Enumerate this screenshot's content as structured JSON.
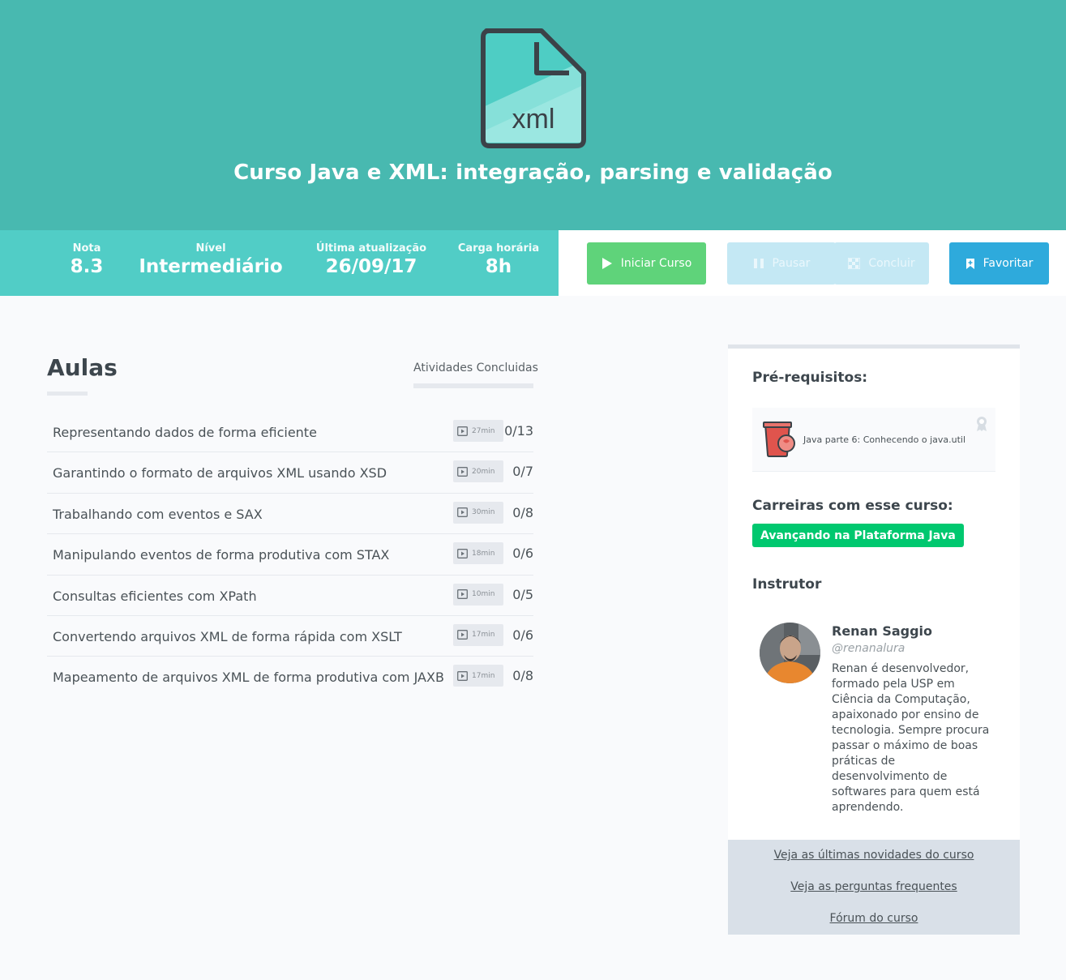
{
  "course": {
    "title": "Curso Java e XML: integração, parsing e validação",
    "icon": "xml-file-icon",
    "icon_text": "xml"
  },
  "stats": [
    {
      "label": "Nota",
      "value": "8.3"
    },
    {
      "label": "Nível",
      "value": "Intermediário"
    },
    {
      "label": "Última atualização",
      "value": "26/09/17"
    },
    {
      "label": "Carga horária",
      "value": "8h"
    }
  ],
  "actions": {
    "start": "Iniciar Curso",
    "pause": "Pausar",
    "finish": "Concluir",
    "favorite": "Favoritar"
  },
  "lessons": {
    "title": "Aulas",
    "done_label": "Atividades Concluidas",
    "items": [
      {
        "name": "Representando dados de forma eficiente",
        "duration": "27min",
        "progress": "0/13"
      },
      {
        "name": "Garantindo o formato de arquivos XML usando XSD",
        "duration": "20min",
        "progress": "0/7"
      },
      {
        "name": "Trabalhando com eventos e SAX",
        "duration": "30min",
        "progress": "0/8"
      },
      {
        "name": "Manipulando eventos de forma produtiva com STAX",
        "duration": "18min",
        "progress": "0/6"
      },
      {
        "name": "Consultas eficientes com XPath",
        "duration": "10min",
        "progress": "0/5"
      },
      {
        "name": "Convertendo arquivos XML de forma rápida com XSLT",
        "duration": "17min",
        "progress": "0/6"
      },
      {
        "name": "Mapeamento de arquivos XML de forma produtiva com JAXB",
        "duration": "17min",
        "progress": "0/8"
      }
    ]
  },
  "sidebar": {
    "prereq_title": "Pré-requisitos:",
    "prereq_course": "Java parte 6: Conhecendo o java.util",
    "careers_title": "Carreiras com esse curso:",
    "career": "Avançando na Plataforma Java",
    "instructor_title": "Instrutor",
    "instructor": {
      "name": "Renan Saggio",
      "handle": "@renanalura",
      "bio": "Renan é desenvolvedor, formado pela USP em Ciência da Computação, apaixonado por ensino de tecnologia. Sempre procura passar o máximo de boas práticas de desenvolvimento de softwares para quem está aprendendo."
    },
    "links": [
      "Veja as últimas novidades do curso",
      "Veja as perguntas frequentes",
      "Fórum do curso"
    ]
  },
  "colors": {
    "hero": "#48b9b0",
    "stats_bar": "#51cdc6",
    "start_button": "#5fd37a",
    "disabled_button": "#c4e8f4",
    "favorite_button": "#2eaadc",
    "career_badge": "#00c86f"
  }
}
